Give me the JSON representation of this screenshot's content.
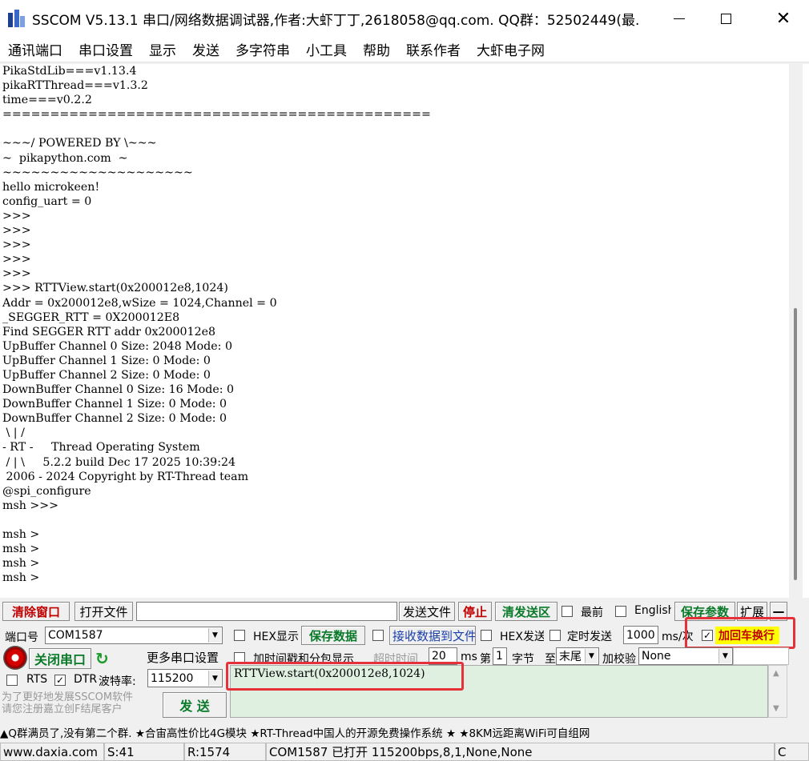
{
  "window": {
    "title": "SSCOM V5.13.1 串口/网络数据调试器,作者:大虾丁丁,2618058@qq.com. QQ群：52502449(最..."
  },
  "menu": [
    "通讯端口",
    "串口设置",
    "显示",
    "发送",
    "多字符串",
    "小工具",
    "帮助",
    "联系作者",
    "大虾电子网"
  ],
  "receive": {
    "lines": [
      "PikaStdLib===v1.13.4",
      "pikaRTThread===v1.3.2",
      "time===v0.2.2",
      "=============================================",
      "",
      "~~~/ POWERED BY \\~~~",
      "~  pikapython.com  ~",
      "~~~~~~~~~~~~~~~~~~~~",
      "hello microkeen!",
      "config_uart = 0",
      ">>>",
      ">>>",
      ">>>",
      ">>>",
      ">>>",
      ">>> RTTView.start(0x200012e8,1024)",
      "Addr = 0x200012e8,wSize = 1024,Channel = 0",
      "_SEGGER_RTT = 0X200012E8",
      "Find SEGGER RTT addr 0x200012e8",
      "UpBuffer Channel 0 Size: 2048 Mode: 0",
      "UpBuffer Channel 1 Size: 0 Mode: 0",
      "UpBuffer Channel 2 Size: 0 Mode: 0",
      "DownBuffer Channel 0 Size: 16 Mode: 0",
      "DownBuffer Channel 1 Size: 0 Mode: 0",
      "DownBuffer Channel 2 Size: 0 Mode: 0",
      " \\ | /",
      "- RT -     Thread Operating System",
      " / | \\     5.2.2 build Dec 17 2025 10:39:24",
      " 2006 - 2024 Copyright by RT-Thread team",
      "@spi_configure",
      "msh >>>",
      "",
      "msh >",
      "msh >",
      "msh >",
      "msh >"
    ]
  },
  "controls": {
    "clear_window": "清除窗口",
    "open_file": "打开文件",
    "send_file": "发送文件",
    "stop": "停止",
    "clear_send": "清发送区",
    "topmost": "最前",
    "english": "English",
    "save_params": "保存参数",
    "expand": "扩展",
    "collapse": "—",
    "port_label": "端口号",
    "port_value": "COM1587",
    "close_port": "关闭串口",
    "more_settings": "更多串口设置",
    "rts": "RTS",
    "dtr": "DTR",
    "baud_label": "波特率:",
    "baud_value": "115200",
    "hex_display": "HEX显示",
    "save_data": "保存数据",
    "recv_to_file": "接收数据到文件",
    "hex_send": "HEX发送",
    "timed_send": "定时发送",
    "interval_value": "1000",
    "interval_unit": "ms/次",
    "add_crlf": "加回车换行",
    "timestamp_split": "加时间戳和分包显示",
    "timeout_label": "超时时间",
    "timeout_value": "20",
    "timeout_unit": "ms",
    "nth_label": "第",
    "nth_value": "1",
    "byte_label": "字节",
    "to_label": "至",
    "to_value": "末尾",
    "checksum_label": "加校验",
    "checksum_value": "None",
    "promo_line1": "为了更好地发展SSCOM软件",
    "promo_line2": "请您注册嘉立创F结尾客户",
    "send_button": "发 送",
    "send_text": "RTTView.start(0x200012e8,1024)"
  },
  "adline": "▲Q群满员了,没有第二个群.   ★合宙高性价比4G模块   ★RT-Thread中国人的开源免费操作系统   ★ ★8KM远距离WiFi可自组网",
  "status": {
    "website": "www.daxia.com",
    "sent": "S:41",
    "received": "R:1574",
    "port_status": "COM1587 已打开  115200bps,8,1,None,None",
    "cts": "C"
  },
  "colors": {
    "highlight_box": "#e5323a",
    "send_area": "#e0f0e0",
    "crlf_highlight": "#ffff00"
  }
}
